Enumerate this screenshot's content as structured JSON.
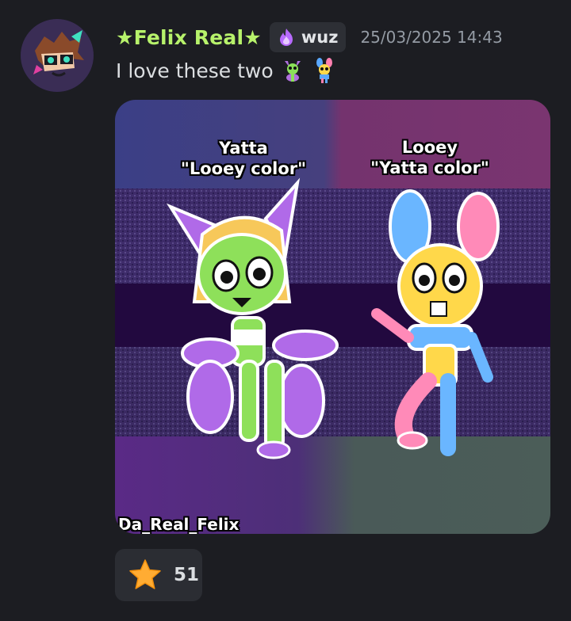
{
  "message": {
    "username": "★Felix Real★",
    "tag": {
      "icon": "purple-flame-icon",
      "text": "wuz"
    },
    "timestamp": "25/03/2025 14:43",
    "content_text": "I love these two",
    "content_emojis": [
      "yatta-emoji",
      "looey-emoji"
    ]
  },
  "attachment": {
    "left_label": "Yatta\n\"Looey color\"",
    "right_label": "Looey\n\"Yatta color\"",
    "signature": "Da_Real_Felix"
  },
  "reaction": {
    "emoji": "star-icon",
    "count": "51"
  },
  "colors": {
    "background": "#1c1d22",
    "username": "#b7f26b",
    "timestamp": "#949ba4",
    "tag_bg": "#2d2f35",
    "reaction_bg": "#2b2d33"
  }
}
